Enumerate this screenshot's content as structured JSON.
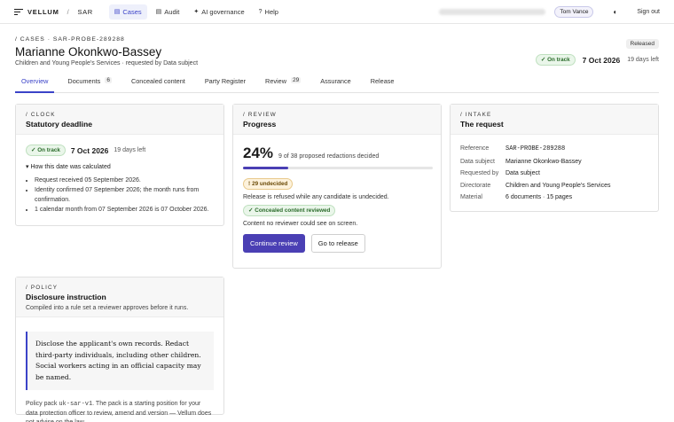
{
  "app": {
    "brand": "VELLUM",
    "brand_sub": "SAR",
    "nav": [
      {
        "label": "Cases",
        "icon": "cases-icon",
        "active": true
      },
      {
        "label": "Audit",
        "icon": "audit-icon",
        "active": false
      },
      {
        "label": "AI governance",
        "icon": "sparkle-icon",
        "active": false
      },
      {
        "label": "Help",
        "icon": "help-icon",
        "active": false
      }
    ],
    "user": "Tom Vance",
    "signout": "Sign out"
  },
  "case": {
    "crumb": "/ CASES · SAR-PROBE-289288",
    "title": "Marianne Okonkwo-Bassey",
    "subtitle": "Children and Young People's Services · requested by Data subject",
    "badge": "Released",
    "status": "On track",
    "due_date": "7 Oct 2026",
    "days_left": "19 days left"
  },
  "tabs": [
    {
      "label": "Overview",
      "count": ""
    },
    {
      "label": "Documents",
      "count": "6"
    },
    {
      "label": "Concealed content",
      "count": ""
    },
    {
      "label": "Party Register",
      "count": ""
    },
    {
      "label": "Review",
      "count": "29"
    },
    {
      "label": "Assurance",
      "count": ""
    },
    {
      "label": "Release",
      "count": ""
    }
  ],
  "clock": {
    "kicker": "/ CLOCK",
    "title": "Statutory deadline",
    "status": "On track",
    "date": "7 Oct 2026",
    "days_left": "19 days left",
    "disclose_label": "How this date was calculated",
    "steps": [
      "Request received 05 September 2026.",
      "Identity confirmed 07 September 2026; the month runs from confirmation.",
      "1 calendar month from 07 September 2026 is 07 October 2026."
    ]
  },
  "review": {
    "kicker": "/ REVIEW",
    "title": "Progress",
    "percent_label": "24%",
    "progress": 0.24,
    "note": "9 of 38 proposed redactions decided",
    "undecided": "29 undecided",
    "refused_note": "Release is refused while any candidate is undecided.",
    "concealed_pill": "Concealed content reviewed",
    "concealed_note": "Content no reviewer could see on screen.",
    "continue_label": "Continue review",
    "release_label": "Go to release"
  },
  "intake": {
    "kicker": "/ INTAKE",
    "title": "The request",
    "rows": [
      {
        "key": "Reference",
        "value": "SAR-PROBE-289288"
      },
      {
        "key": "Data subject",
        "value": "Marianne Okonkwo-Bassey"
      },
      {
        "key": "Requested by",
        "value": "Data subject"
      },
      {
        "key": "Directorate",
        "value": "Children and Young People's Services"
      },
      {
        "key": "Material",
        "value": "6 documents · 15 pages"
      }
    ]
  },
  "policy": {
    "kicker": "/ POLICY",
    "title": "Disclosure instruction",
    "subtitle": "Compiled into a rule set a reviewer approves before it runs.",
    "quote": "Disclose the applicant's own records. Redact third-party individuals, including other children. Social workers acting in an official capacity may be named.",
    "note_prefix": "Policy pack ",
    "pack": "uk-sar-v1",
    "note_suffix": ". The pack is a starting position for your data protection officer to review, amend and version — Vellum does not advise on the law."
  }
}
